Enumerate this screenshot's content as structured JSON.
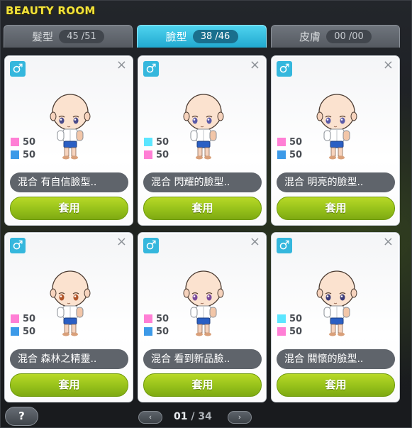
{
  "window": {
    "title": "BEAUTY ROOM"
  },
  "tabs": [
    {
      "label": "髮型",
      "count": "45 /51",
      "active": false
    },
    {
      "label": "臉型",
      "count": "38 /46",
      "active": true
    },
    {
      "label": "皮膚",
      "count": "00 /00",
      "active": false
    }
  ],
  "colors": {
    "accent": "#21a9cf",
    "apply_button": "#96c11a",
    "pink_swatch": "#ff7fd5",
    "blue_swatch": "#3d9ae8",
    "cyan_swatch": "#5ce6ff",
    "gender_badge": "#35b7dd"
  },
  "cards": [
    {
      "gender_icon": "male-symbol",
      "stats": [
        {
          "color": "#ff7fd5",
          "value": "50"
        },
        {
          "color": "#3d9ae8",
          "value": "50"
        }
      ],
      "name": "混合 有自信臉型..",
      "apply_label": "套用",
      "eye": "#4a4a8a"
    },
    {
      "gender_icon": "male-symbol",
      "stats": [
        {
          "color": "#5ce6ff",
          "value": "50"
        },
        {
          "color": "#ff7fd5",
          "value": "50"
        }
      ],
      "name": "混合 閃耀的臉型..",
      "apply_label": "套用",
      "eye": "#5a5aa8"
    },
    {
      "gender_icon": "male-symbol",
      "stats": [
        {
          "color": "#ff7fd5",
          "value": "50"
        },
        {
          "color": "#3d9ae8",
          "value": "50"
        }
      ],
      "name": "混合 明亮的臉型..",
      "apply_label": "套用",
      "eye": "#5a5aa8"
    },
    {
      "gender_icon": "male-symbol",
      "stats": [
        {
          "color": "#ff7fd5",
          "value": "50"
        },
        {
          "color": "#3d9ae8",
          "value": "50"
        }
      ],
      "name": "混合 森林之精靈..",
      "apply_label": "套用",
      "eye": "#b0552a"
    },
    {
      "gender_icon": "male-symbol",
      "stats": [
        {
          "color": "#ff7fd5",
          "value": "50"
        },
        {
          "color": "#3d9ae8",
          "value": "50"
        }
      ],
      "name": "混合 看到新品臉..",
      "apply_label": "套用",
      "eye": "#7a4a9a"
    },
    {
      "gender_icon": "male-symbol",
      "stats": [
        {
          "color": "#5ce6ff",
          "value": "50"
        },
        {
          "color": "#ff7fd5",
          "value": "50"
        }
      ],
      "name": "混合 關懷的臉型..",
      "apply_label": "套用",
      "eye": "#3a3a78"
    }
  ],
  "footer": {
    "help_label": "?",
    "prev_icon": "chevron-left-icon",
    "next_icon": "chevron-right-icon",
    "prev_label": "‹",
    "next_label": "›",
    "page_current": "01",
    "page_sep": " / ",
    "page_total": "34"
  }
}
